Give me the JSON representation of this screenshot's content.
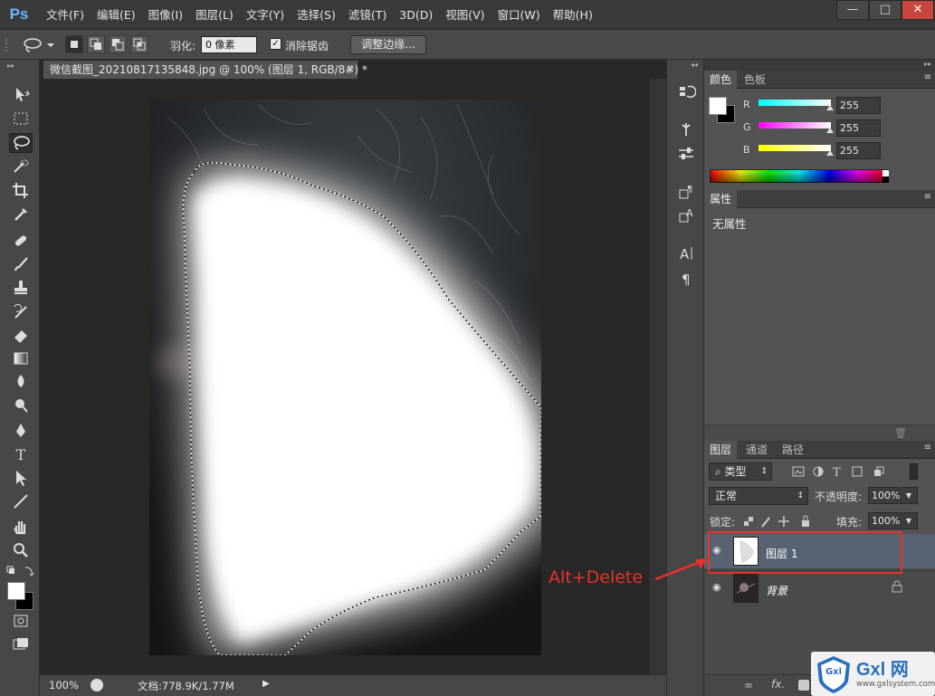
{
  "app": {
    "logo": "Ps"
  },
  "menu": [
    "文件(F)",
    "编辑(E)",
    "图像(I)",
    "图层(L)",
    "文字(Y)",
    "选择(S)",
    "滤镜(T)",
    "3D(D)",
    "视图(V)",
    "窗口(W)",
    "帮助(H)"
  ],
  "window_buttons": {
    "minimize": "—",
    "maximize": "□",
    "close": "✕"
  },
  "options": {
    "feather_label": "羽化:",
    "feather_value": "0 像素",
    "antialias_check": "✓",
    "antialias_label": "消除锯齿",
    "refine_button": "调整边缘..."
  },
  "document": {
    "tab_title": "微信截图_20210817135848.jpg @ 100% (图层 1, RGB/8#) *",
    "close": "×"
  },
  "status": {
    "zoom": "100%",
    "doc_info": "文档:778.9K/1.77M"
  },
  "color_panel": {
    "tabs": [
      "颜色",
      "色板"
    ],
    "channels": [
      {
        "label": "R",
        "value": "255",
        "gradient": [
          "#00ffff",
          "#ffffff"
        ]
      },
      {
        "label": "G",
        "value": "255",
        "gradient": [
          "#ff00ff",
          "#ffffff"
        ]
      },
      {
        "label": "B",
        "value": "255",
        "gradient": [
          "#ffff00",
          "#ffffff"
        ]
      }
    ],
    "foreground": "#ffffff",
    "background": "#000000"
  },
  "properties_panel": {
    "tab": "属性",
    "content": "无属性"
  },
  "layers_panel": {
    "tabs": [
      "图层",
      "通道",
      "路径"
    ],
    "filter_label": "⌕ 类型",
    "blend_mode": "正常",
    "opacity_label": "不透明度:",
    "opacity_value": "100%",
    "lock_label": "锁定:",
    "fill_label": "填充:",
    "fill_value": "100%",
    "layers": [
      {
        "name": "图层 1",
        "selected": true
      },
      {
        "name": "背景",
        "locked": true
      }
    ],
    "bottom_icons": [
      "link-icon",
      "fx-icon",
      "mask-icon"
    ]
  },
  "annotation": {
    "text": "Alt+Delete",
    "color": "#e8322a"
  },
  "watermark": {
    "brand": "Gxl 网",
    "url": "www.gxlsystem.com",
    "badge": "Gxl"
  }
}
